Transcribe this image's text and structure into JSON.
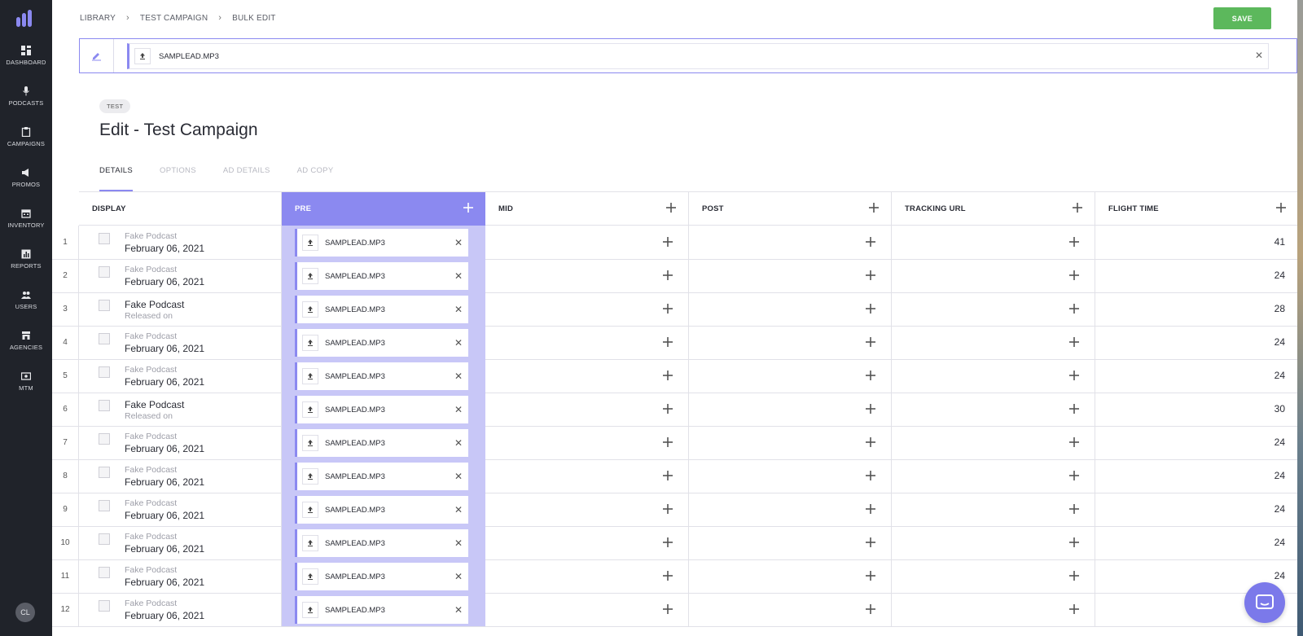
{
  "sidebar": {
    "items": [
      {
        "label": "DASHBOARD",
        "icon": "dashboard-icon"
      },
      {
        "label": "PODCASTS",
        "icon": "microphone-icon"
      },
      {
        "label": "CAMPAIGNS",
        "icon": "clipboard-icon"
      },
      {
        "label": "PROMOS",
        "icon": "megaphone-icon"
      },
      {
        "label": "INVENTORY",
        "icon": "calendar-icon"
      },
      {
        "label": "REPORTS",
        "icon": "bar-chart-icon"
      },
      {
        "label": "USERS",
        "icon": "users-icon"
      },
      {
        "label": "AGENCIES",
        "icon": "storefront-icon"
      },
      {
        "label": "MTM",
        "icon": "money-icon"
      }
    ],
    "avatar": "CL"
  },
  "breadcrumb": [
    "LIBRARY",
    "TEST CAMPAIGN",
    "BULK EDIT"
  ],
  "save_label": "SAVE",
  "bulk_file": "SAMPLEAD.MP3",
  "tag": "TEST",
  "title": "Edit - Test Campaign",
  "tabs": [
    "DETAILS",
    "OPTIONS",
    "AD DETAILS",
    "AD COPY"
  ],
  "columns": [
    "DISPLAY",
    "PRE",
    "MID",
    "POST",
    "TRACKING URL",
    "FLIGHT TIME"
  ],
  "rows": [
    {
      "num": "1",
      "line1": "Fake Podcast",
      "line2": "February 06, 2021",
      "pre": "SAMPLEAD.MP3",
      "flight": "41"
    },
    {
      "num": "2",
      "line1": "Fake Podcast",
      "line2": "February 06, 2021",
      "pre": "SAMPLEAD.MP3",
      "flight": "24"
    },
    {
      "num": "3",
      "line1": "Fake Podcast",
      "line2": "Released on",
      "pre": "SAMPLEAD.MP3",
      "flight": "28"
    },
    {
      "num": "4",
      "line1": "Fake Podcast",
      "line2": "February 06, 2021",
      "pre": "SAMPLEAD.MP3",
      "flight": "24"
    },
    {
      "num": "5",
      "line1": "Fake Podcast",
      "line2": "February 06, 2021",
      "pre": "SAMPLEAD.MP3",
      "flight": "24"
    },
    {
      "num": "6",
      "line1": "Fake Podcast",
      "line2": "Released on",
      "pre": "SAMPLEAD.MP3",
      "flight": "30"
    },
    {
      "num": "7",
      "line1": "Fake Podcast",
      "line2": "February 06, 2021",
      "pre": "SAMPLEAD.MP3",
      "flight": "24"
    },
    {
      "num": "8",
      "line1": "Fake Podcast",
      "line2": "February 06, 2021",
      "pre": "SAMPLEAD.MP3",
      "flight": "24"
    },
    {
      "num": "9",
      "line1": "Fake Podcast",
      "line2": "February 06, 2021",
      "pre": "SAMPLEAD.MP3",
      "flight": "24"
    },
    {
      "num": "10",
      "line1": "Fake Podcast",
      "line2": "February 06, 2021",
      "pre": "SAMPLEAD.MP3",
      "flight": "24"
    },
    {
      "num": "11",
      "line1": "Fake Podcast",
      "line2": "February 06, 2021",
      "pre": "SAMPLEAD.MP3",
      "flight": "24"
    },
    {
      "num": "12",
      "line1": "Fake Podcast",
      "line2": "February 06, 2021",
      "pre": "SAMPLEAD.MP3",
      "flight": ""
    }
  ],
  "colors": {
    "sidebar": "#20232a",
    "accent": "#8b89f0",
    "pre_column": "#c8c7f7",
    "save": "#5cb85c"
  }
}
